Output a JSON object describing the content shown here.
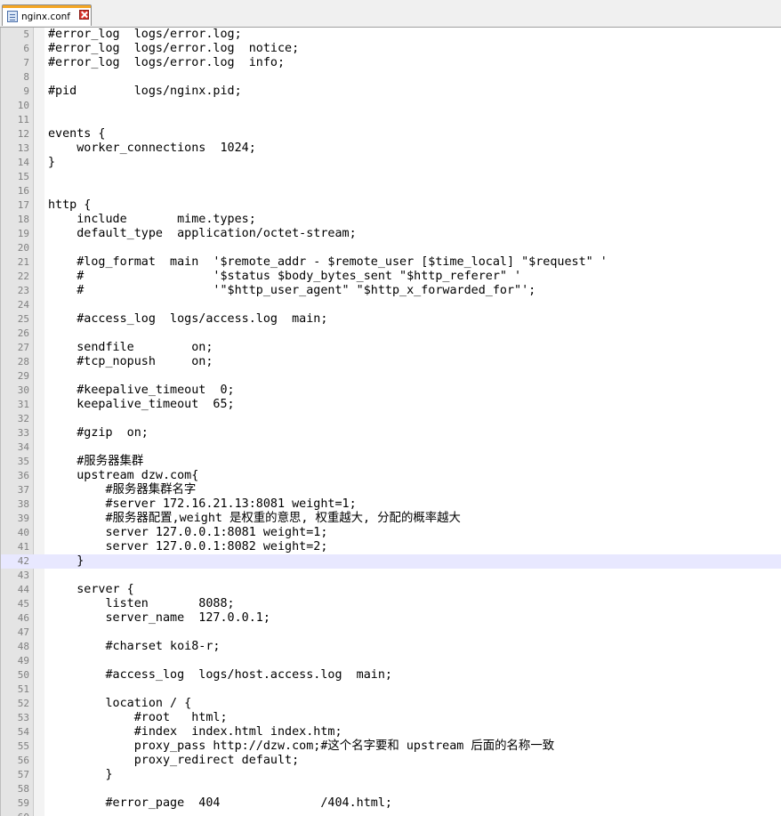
{
  "tab": {
    "label": "nginx.conf",
    "icon": "file-icon",
    "close_icon": "close-icon",
    "accent_color": "#f5a623"
  },
  "editor": {
    "current_line": 42,
    "lines": [
      {
        "n": "5",
        "text": "#error_log  logs/error.log;"
      },
      {
        "n": "6",
        "text": "#error_log  logs/error.log  notice;"
      },
      {
        "n": "7",
        "text": "#error_log  logs/error.log  info;"
      },
      {
        "n": "8",
        "text": ""
      },
      {
        "n": "9",
        "text": "#pid        logs/nginx.pid;"
      },
      {
        "n": "10",
        "text": ""
      },
      {
        "n": "11",
        "text": ""
      },
      {
        "n": "12",
        "text": "events {"
      },
      {
        "n": "13",
        "text": "    worker_connections  1024;"
      },
      {
        "n": "14",
        "text": "}"
      },
      {
        "n": "15",
        "text": ""
      },
      {
        "n": "16",
        "text": ""
      },
      {
        "n": "17",
        "text": "http {"
      },
      {
        "n": "18",
        "text": "    include       mime.types;"
      },
      {
        "n": "19",
        "text": "    default_type  application/octet-stream;"
      },
      {
        "n": "20",
        "text": ""
      },
      {
        "n": "21",
        "text": "    #log_format  main  '$remote_addr - $remote_user [$time_local] \"$request\" '"
      },
      {
        "n": "22",
        "text": "    #                  '$status $body_bytes_sent \"$http_referer\" '"
      },
      {
        "n": "23",
        "text": "    #                  '\"$http_user_agent\" \"$http_x_forwarded_for\"';"
      },
      {
        "n": "24",
        "text": ""
      },
      {
        "n": "25",
        "text": "    #access_log  logs/access.log  main;"
      },
      {
        "n": "26",
        "text": ""
      },
      {
        "n": "27",
        "text": "    sendfile        on;"
      },
      {
        "n": "28",
        "text": "    #tcp_nopush     on;"
      },
      {
        "n": "29",
        "text": ""
      },
      {
        "n": "30",
        "text": "    #keepalive_timeout  0;"
      },
      {
        "n": "31",
        "text": "    keepalive_timeout  65;"
      },
      {
        "n": "32",
        "text": ""
      },
      {
        "n": "33",
        "text": "    #gzip  on;"
      },
      {
        "n": "34",
        "text": ""
      },
      {
        "n": "35",
        "text": "    #服务器集群"
      },
      {
        "n": "36",
        "text": "    upstream dzw.com{"
      },
      {
        "n": "37",
        "text": "        #服务器集群名字"
      },
      {
        "n": "38",
        "text": "        #server 172.16.21.13:8081 weight=1;"
      },
      {
        "n": "39",
        "text": "        #服务器配置,weight 是权重的意思, 权重越大, 分配的概率越大"
      },
      {
        "n": "40",
        "text": "        server 127.0.0.1:8081 weight=1;"
      },
      {
        "n": "41",
        "text": "        server 127.0.0.1:8082 weight=2;"
      },
      {
        "n": "42",
        "text": "    }"
      },
      {
        "n": "43",
        "text": ""
      },
      {
        "n": "44",
        "text": "    server {"
      },
      {
        "n": "45",
        "text": "        listen       8088;"
      },
      {
        "n": "46",
        "text": "        server_name  127.0.0.1;"
      },
      {
        "n": "47",
        "text": ""
      },
      {
        "n": "48",
        "text": "        #charset koi8-r;"
      },
      {
        "n": "49",
        "text": ""
      },
      {
        "n": "50",
        "text": "        #access_log  logs/host.access.log  main;"
      },
      {
        "n": "51",
        "text": ""
      },
      {
        "n": "52",
        "text": "        location / {"
      },
      {
        "n": "53",
        "text": "            #root   html;"
      },
      {
        "n": "54",
        "text": "            #index  index.html index.htm;"
      },
      {
        "n": "55",
        "text": "            proxy_pass http://dzw.com;#这个名字要和 upstream 后面的名称一致"
      },
      {
        "n": "56",
        "text": "            proxy_redirect default;"
      },
      {
        "n": "57",
        "text": "        }"
      },
      {
        "n": "58",
        "text": ""
      },
      {
        "n": "59",
        "text": "        #error_page  404              /404.html;"
      },
      {
        "n": "60",
        "text": ""
      }
    ]
  }
}
